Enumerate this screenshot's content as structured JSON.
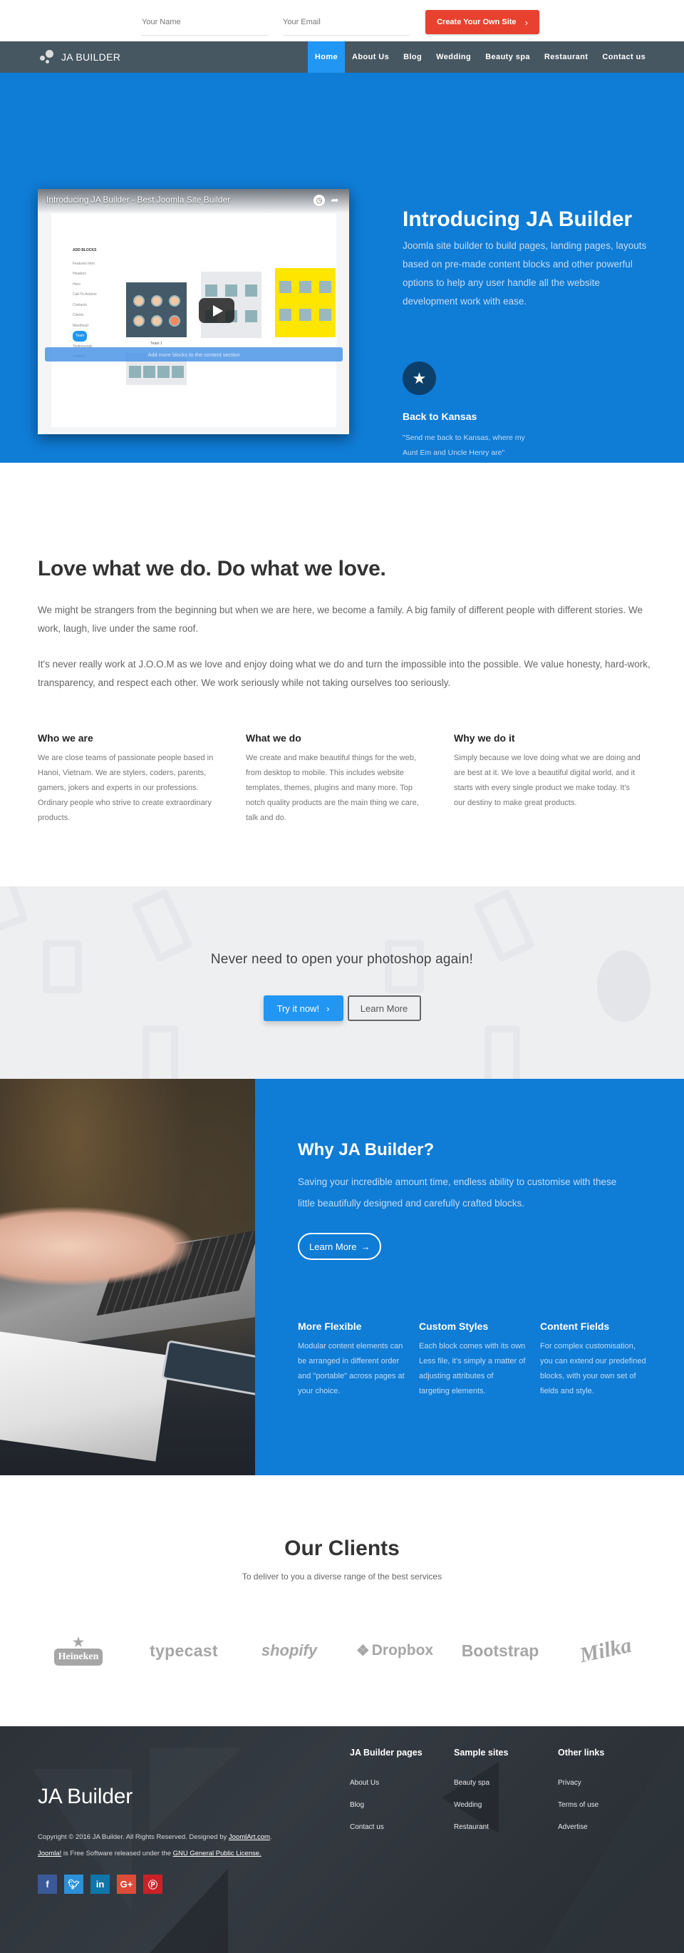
{
  "signup": {
    "name_placeholder": "Your Name",
    "email_placeholder": "Your Email",
    "cta_label": "Create Your Own Site",
    "cta_icon": "chevron-right-icon"
  },
  "navbar": {
    "logo_text": "JA BUILDER",
    "items": [
      {
        "label": "Home",
        "active": true
      },
      {
        "label": "About Us"
      },
      {
        "label": "Blog"
      },
      {
        "label": "Wedding"
      },
      {
        "label": "Beauty spa"
      },
      {
        "label": "Restaurant"
      },
      {
        "label": "Contact us"
      }
    ]
  },
  "hero": {
    "video": {
      "title": "Introducing JA Builder - Best Joomla Site Builder",
      "sidebar_heading": "ADD BLOCKS",
      "sidebar_items": [
        "Features Intro",
        "Headers",
        "Hero",
        "Call-To-Actions",
        "Contacts",
        "Clients",
        "Masthead",
        "Team",
        "Testimonials",
        "Footers"
      ],
      "selected_item": "Team",
      "thumb_label": "Team 1",
      "add_bar": "Add more blocks to the content section"
    },
    "title": "Introducing JA Builder",
    "description": "Joomla site builder to build pages, landing pages, layouts based on pre-made content blocks and other powerful options to help any user handle all the website development work with ease.",
    "feature": {
      "icon": "star-icon",
      "title": "Back to Kansas",
      "quote": "\"Send me back to Kansas, where my Aunt Em and Uncle Henry are\""
    }
  },
  "about": {
    "title": "Love what we do. Do what we love.",
    "paragraphs": [
      "We might be strangers from the beginning but when we are here, we become a family. A big family of different people with different stories. We work, laugh, live under the same roof.",
      "It's never really work at J.O.O.M as we love and enjoy doing what we do and turn the impossible into the possible. We value honesty, hard-work, transparency, and respect each other. We work seriously while not taking ourselves too seriously."
    ],
    "columns": [
      {
        "title": "Who we are",
        "text": "We are close teams of passionate people based in Hanoi, Vietnam. We are stylers, coders, parents, gamers, jokers and experts in our professions. Ordinary people who strive to create extraordinary products."
      },
      {
        "title": "What we do",
        "text": "We create and make beautiful things for the web, from desktop to mobile. This includes website templates, themes, plugins and many more. Top notch quality products are the main thing we care, talk and do."
      },
      {
        "title": "Why we do it",
        "text": "Simply because we love doing what we are doing and are best at it. We love a beautiful digital world, and it starts with every single product we make today. It's our destiny to make great products."
      }
    ]
  },
  "cta": {
    "heading": "Never need to open your photoshop again!",
    "try_label": "Try it now!",
    "learn_label": "Learn More"
  },
  "why": {
    "title": "Why JA Builder?",
    "description": "Saving your incredible amount time, endless ability to customise with these little beautifully designed and carefully crafted blocks.",
    "button_label": "Learn More",
    "features": [
      {
        "title": "More Flexible",
        "text": "Modular content elements can be arranged in different order and \"portable\" across pages at your choice."
      },
      {
        "title": "Custom Styles",
        "text": "Each block comes with its own Less file, it's simply a matter of adjusting attributes of targeting elements."
      },
      {
        "title": "Content Fields",
        "text": "For complex customisation, you can extend our predefined blocks, with your own set of fields and style."
      }
    ]
  },
  "clients": {
    "title": "Our Clients",
    "subtitle": "To deliver to you a diverse range of the best services",
    "logos": [
      "Heineken",
      "typecast",
      "shopify",
      "Dropbox",
      "Bootstrap",
      "Milka"
    ]
  },
  "footer": {
    "brand": "JA Builder",
    "copyright_prefix": "Copyright © 2016 JA Builder. All Rights Reserved. Designed by ",
    "designer_link": "JoomlArt.com",
    "joomla_link": "Joomla!",
    "license_middle": " is Free Software released under the ",
    "license_link": "GNU General Public License.",
    "socials": [
      {
        "name": "facebook",
        "glyph": "f",
        "color": "#3b5998"
      },
      {
        "name": "twitter",
        "glyph": "t",
        "color": "#2b90d9"
      },
      {
        "name": "linkedin",
        "glyph": "in",
        "color": "#0e76a8"
      },
      {
        "name": "google-plus",
        "glyph": "G+",
        "color": "#dd4b39"
      },
      {
        "name": "pinterest",
        "glyph": "P",
        "color": "#cb2027"
      }
    ],
    "columns": [
      {
        "title": "JA Builder pages",
        "links": [
          "About Us",
          "Blog",
          "Contact us"
        ]
      },
      {
        "title": "Sample sites",
        "links": [
          "Beauty spa",
          "Wedding",
          "Restaurant"
        ]
      },
      {
        "title": "Other links",
        "links": [
          "Privacy",
          "Terms of use",
          "Advertise"
        ]
      }
    ]
  },
  "colors": {
    "primary_blue": "#0f7cd6",
    "nav_active": "#2196f3",
    "navbar_bg": "#475762",
    "cta_red": "#e8412f",
    "footer_bg": "#2c3238"
  }
}
